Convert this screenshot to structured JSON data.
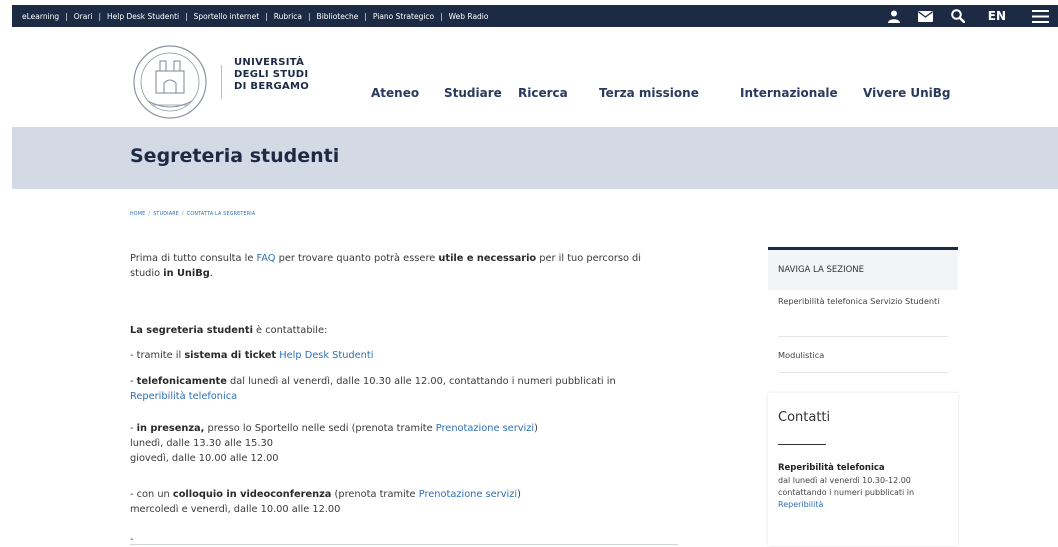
{
  "topbar": {
    "links": [
      "eLearning",
      "Orari",
      "Help Desk Studenti",
      "Sportello internet",
      "Rubrica",
      "Biblioteche",
      "Piano Strategico",
      "Web Radio"
    ],
    "icons": [
      "user-icon",
      "mail-icon",
      "search-icon",
      "menu-icon"
    ],
    "lang": "EN"
  },
  "logo": {
    "line1": "UNIVERSITÀ",
    "line2": "DEGLI STUDI",
    "line3": "DI BERGAMO"
  },
  "nav": [
    "Ateneo",
    "Studiare",
    "Ricerca",
    "Terza missione",
    "Internazionale",
    "Vivere UniBg"
  ],
  "page": {
    "title": "Segreteria studenti",
    "breadcrumb": [
      "HOME",
      "STUDIARE",
      "CONTATTA LA SEGRETERIA"
    ]
  },
  "content": {
    "p1a": "Prima di tutto consulta le ",
    "p1_faq": "FAQ",
    "p1b": " per trovare quanto potrà essere ",
    "p1_bold1": "utile e necessario",
    "p1c": " per il tuo percorso di studio ",
    "p1_bold2": "in UniBg",
    "p1d": ".",
    "p2_bold": "La segreteria studenti",
    "p2_rest": " è contattabile:",
    "p3a": "- tramite il ",
    "p3_bold": "sistema di ticket",
    "p3_link": "Help Desk Studenti",
    "p4a": "- ",
    "p4_bold": "telefonicamente",
    "p4b": " dal lunedì al venerdì, dalle 10.30 alle 12.00, contattando i numeri pubblicati in ",
    "p4_link": "Reperibilità telefonica",
    "p5a": "- ",
    "p5_bold": "in presenza,",
    "p5b": " presso lo Sportello nelle sedi (prenota tramite ",
    "p5_link": "Prenotazione servizi",
    "p5c": ")",
    "p5_line2": "lunedì, dalle 13.30 alle 15.30",
    "p5_line3": "giovedì, dalle 10.00 alle 12.00",
    "p6a": "- con un ",
    "p6_bold": "colloquio in videoconferenza",
    "p6b": " (prenota tramite ",
    "p6_link": "Prenotazione servizi",
    "p6c": ")",
    "p6_line2": "mercoledì e venerdì, dalle 10.00 alle 12.00",
    "p7": "-"
  },
  "sidebar": {
    "nav_heading": "NAVIGA LA SEZIONE",
    "items": [
      "Reperibilità telefonica Servizio Studenti",
      "Modulistica"
    ],
    "contacts_title": "Contatti",
    "contact_heading": "Reperibilità telefonica",
    "contact_text": "dal lunedì al venerdì 10.30-12.00 contattando i numeri pubblicati in ",
    "contact_link": "Reperibilità"
  },
  "colors": {
    "navy": "#1d2a44",
    "band": "#d3dae6",
    "link": "#2f6fb5"
  }
}
